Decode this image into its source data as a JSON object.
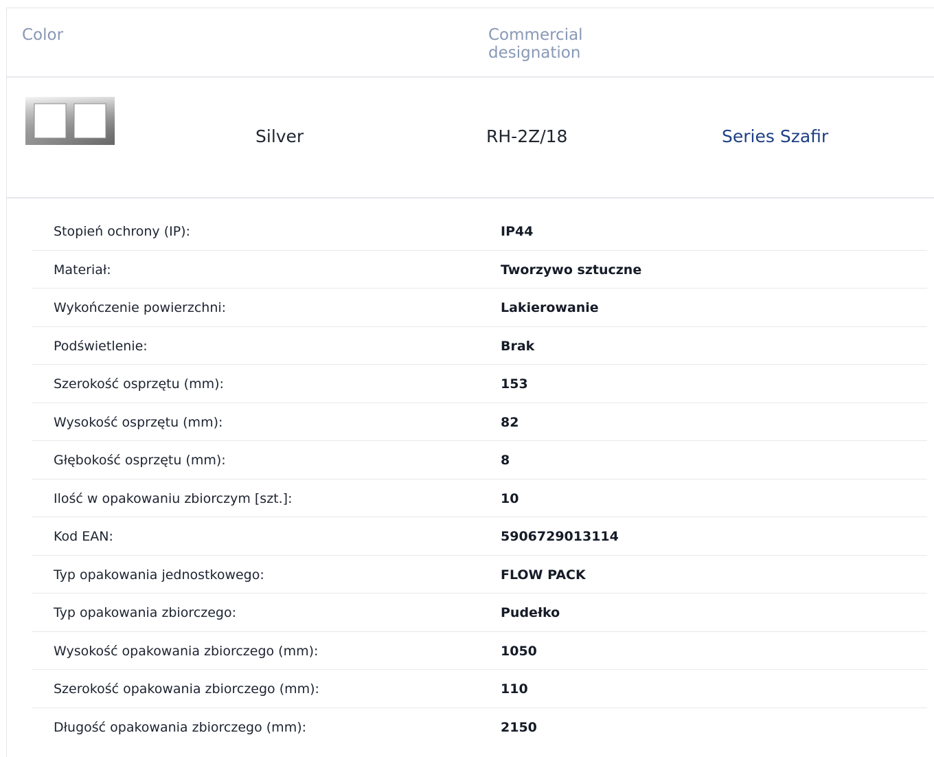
{
  "header": {
    "color_label": "Color",
    "designation_label": "Commercial designation"
  },
  "product": {
    "color": "Silver",
    "code": "RH-2Z/18",
    "series": "Series Szafir",
    "thumbnail_icon": "double-frame-silver-icon"
  },
  "specs": [
    {
      "label": "Stopień ochrony (IP):",
      "value": "IP44"
    },
    {
      "label": "Materiał:",
      "value": "Tworzywo sztuczne"
    },
    {
      "label": "Wykończenie powierzchni:",
      "value": "Lakierowanie"
    },
    {
      "label": "Podświetlenie:",
      "value": "Brak"
    },
    {
      "label": "Szerokość osprzętu (mm):",
      "value": "153"
    },
    {
      "label": "Wysokość osprzętu (mm):",
      "value": "82"
    },
    {
      "label": "Głębokość osprzętu (mm):",
      "value": "8"
    },
    {
      "label": "Ilość w opakowaniu zbiorczym [szt.]:",
      "value": "10"
    },
    {
      "label": "Kod EAN:",
      "value": "5906729013114"
    },
    {
      "label": "Typ opakowania jednostkowego:",
      "value": "FLOW PACK"
    },
    {
      "label": "Typ opakowania zbiorczego:",
      "value": "Pudełko"
    },
    {
      "label": "Wysokość opakowania zbiorczego (mm):",
      "value": "1050"
    },
    {
      "label": "Szerokość opakowania zbiorczego (mm):",
      "value": "110"
    },
    {
      "label": "Długość opakowania zbiorczego (mm):",
      "value": "2150"
    }
  ],
  "colors": {
    "header_text": "#8898b6",
    "series_link": "#1d3f84",
    "divider": "#e6e8ec"
  }
}
